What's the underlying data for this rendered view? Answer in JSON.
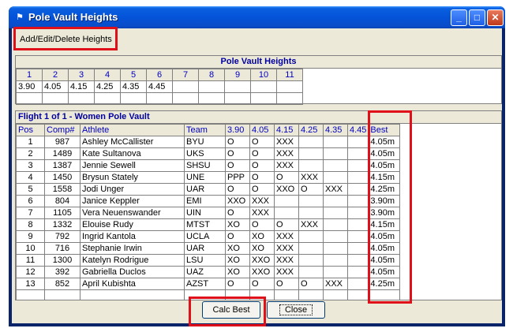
{
  "window": {
    "title": "Pole Vault Heights"
  },
  "menu": {
    "add_edit_delete": "Add/Edit/Delete Heights"
  },
  "heights_panel": {
    "title": "Pole Vault Heights",
    "columns": [
      "1",
      "2",
      "3",
      "4",
      "5",
      "6",
      "7",
      "8",
      "9",
      "10",
      "11"
    ],
    "values": [
      "3.90",
      "4.05",
      "4.15",
      "4.25",
      "4.35",
      "4.45",
      "",
      "",
      "",
      "",
      ""
    ]
  },
  "flight_panel": {
    "title": "Flight 1  of  1 - Women Pole Vault",
    "headers": [
      "Pos",
      "Comp#",
      "Athlete",
      "Team",
      "3.90",
      "4.05",
      "4.15",
      "4.25",
      "4.35",
      "4.45",
      "Best"
    ],
    "rows": [
      {
        "pos": "1",
        "comp": "987",
        "athlete": "Ashley McCallister",
        "team": "BYU",
        "h1": "O",
        "h2": "O",
        "h3": "XXX",
        "h4": "",
        "h5": "",
        "h6": "",
        "best": "4.05m"
      },
      {
        "pos": "2",
        "comp": "1489",
        "athlete": "Kate Sultanova",
        "team": "UKS",
        "h1": "O",
        "h2": "O",
        "h3": "XXX",
        "h4": "",
        "h5": "",
        "h6": "",
        "best": "4.05m"
      },
      {
        "pos": "3",
        "comp": "1387",
        "athlete": "Jennie Sewell",
        "team": "SHSU",
        "h1": "O",
        "h2": "O",
        "h3": "XXX",
        "h4": "",
        "h5": "",
        "h6": "",
        "best": "4.05m"
      },
      {
        "pos": "4",
        "comp": "1450",
        "athlete": "Brysun Stately",
        "team": "UNE",
        "h1": "PPP",
        "h2": "O",
        "h3": "O",
        "h4": "XXX",
        "h5": "",
        "h6": "",
        "best": "4.15m"
      },
      {
        "pos": "5",
        "comp": "1558",
        "athlete": "Jodi Unger",
        "team": "UAR",
        "h1": "O",
        "h2": "O",
        "h3": "XXO",
        "h4": "O",
        "h5": "XXX",
        "h6": "",
        "best": "4.25m"
      },
      {
        "pos": "6",
        "comp": "804",
        "athlete": "Janice Keppler",
        "team": "EMI",
        "h1": "XXO",
        "h2": "XXX",
        "h3": "",
        "h4": "",
        "h5": "",
        "h6": "",
        "best": "3.90m"
      },
      {
        "pos": "7",
        "comp": "1105",
        "athlete": "Vera Neuenswander",
        "team": "UIN",
        "h1": "O",
        "h2": "XXX",
        "h3": "",
        "h4": "",
        "h5": "",
        "h6": "",
        "best": "3.90m"
      },
      {
        "pos": "8",
        "comp": "1332",
        "athlete": "Elouise Rudy",
        "team": "MTST",
        "h1": "XO",
        "h2": "O",
        "h3": "O",
        "h4": "XXX",
        "h5": "",
        "h6": "",
        "best": "4.15m"
      },
      {
        "pos": "9",
        "comp": "792",
        "athlete": "Ingrid Kantola",
        "team": "UCLA",
        "h1": "O",
        "h2": "XO",
        "h3": "XXX",
        "h4": "",
        "h5": "",
        "h6": "",
        "best": "4.05m"
      },
      {
        "pos": "10",
        "comp": "716",
        "athlete": "Stephanie Irwin",
        "team": "UAR",
        "h1": "XO",
        "h2": "XO",
        "h3": "XXX",
        "h4": "",
        "h5": "",
        "h6": "",
        "best": "4.05m"
      },
      {
        "pos": "11",
        "comp": "1300",
        "athlete": "Katelyn Rodrigue",
        "team": "LSU",
        "h1": "XO",
        "h2": "XXO",
        "h3": "XXX",
        "h4": "",
        "h5": "",
        "h6": "",
        "best": "4.05m"
      },
      {
        "pos": "12",
        "comp": "392",
        "athlete": "Gabriella Duclos",
        "team": "UAZ",
        "h1": "XO",
        "h2": "XXO",
        "h3": "XXX",
        "h4": "",
        "h5": "",
        "h6": "",
        "best": "4.05m"
      },
      {
        "pos": "13",
        "comp": "852",
        "athlete": "April Kubishta",
        "team": "AZST",
        "h1": "O",
        "h2": "O",
        "h3": "O",
        "h4": "O",
        "h5": "XXX",
        "h6": "",
        "best": "4.25m"
      }
    ]
  },
  "buttons": {
    "calc_best": "Calc Best",
    "close": "Close"
  },
  "colors": {
    "highlight": "#e0101a",
    "titlebar": "#0453d8",
    "header_text": "#0000c0"
  }
}
